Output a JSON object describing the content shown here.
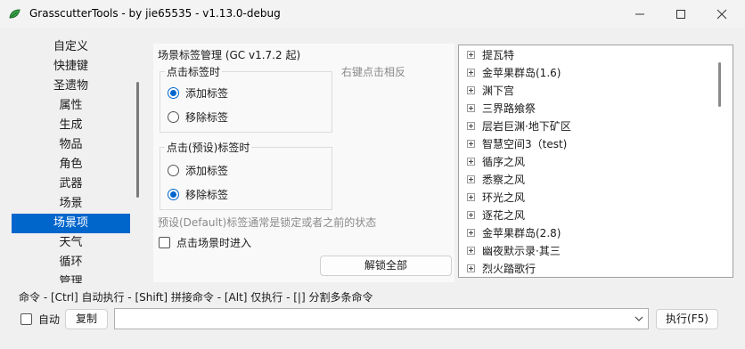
{
  "window": {
    "title": "GrasscutterTools  - by jie65535  - v1.13.0-debug"
  },
  "sidebar": {
    "items": [
      "自定义",
      "快捷键",
      "圣遗物",
      "属性",
      "生成",
      "物品",
      "角色",
      "武器",
      "场景",
      "场景项",
      "天气",
      "循环",
      "管理"
    ],
    "selected_index": 9
  },
  "scene_tags": {
    "title": "场景标签管理 (GC v1.7.2 起)",
    "click_group": {
      "label": "点击标签时",
      "add": "添加标签",
      "remove": "移除标签",
      "selected": "add"
    },
    "right_click_hint": "右键点击相反",
    "preset_group": {
      "label": "点击(预设)标签时",
      "add": "添加标签",
      "remove": "移除标签",
      "selected": "remove"
    },
    "default_hint": "预设(Default)标签通常是锁定或者之前的状态",
    "enter_on_click_label": "点击场景时进入",
    "enter_on_click_checked": false,
    "unlock_all_label": "解锁全部"
  },
  "scene_list": {
    "items": [
      "提瓦特",
      "金苹果群岛(1.6)",
      "渊下宫",
      "三界路飨祭",
      "层岩巨渊·地下矿区",
      "智慧空间3（test)",
      "循序之风",
      "悉察之风",
      "环光之风",
      "逐花之风",
      "金苹果群岛(2.8)",
      "幽夜默示录·其三",
      "烈火踏歌行"
    ]
  },
  "command": {
    "help_text": "命令  - [Ctrl] 自动执行  - [Shift] 拼接命令  - [Alt] 仅执行  - [|] 分割多条命令",
    "auto_label": "自动",
    "auto_checked": false,
    "copy_label": "复制",
    "input_value": "",
    "execute_label": "执行(F5)"
  },
  "colors": {
    "accent": "#0066cc",
    "app_icon": "#3aa24a"
  }
}
